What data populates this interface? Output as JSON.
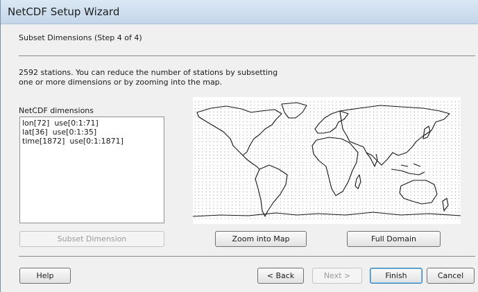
{
  "window": {
    "title": "NetCDF Setup Wizard"
  },
  "step": {
    "title": "Subset Dimensions (Step 4 of 4)"
  },
  "description": {
    "line1": "2592 stations. You can reduce the number of stations by subsetting",
    "line2": "one or more dimensions or by zooming into the map."
  },
  "dimensions": {
    "label": "NetCDF dimensions",
    "items": [
      "lon[72]  use[0:1:71]",
      "lat[36]  use[0:1:35]",
      "time[1872]  use[0:1:1871]"
    ]
  },
  "buttons": {
    "subset_dimension": "Subset Dimension",
    "zoom_into_map": "Zoom into Map",
    "full_domain": "Full Domain",
    "help": "Help",
    "back": "< Back",
    "next": "Next >",
    "finish": "Finish",
    "cancel": "Cancel"
  },
  "map": {
    "grid_lon_count": 72,
    "grid_lat_count": 36
  }
}
